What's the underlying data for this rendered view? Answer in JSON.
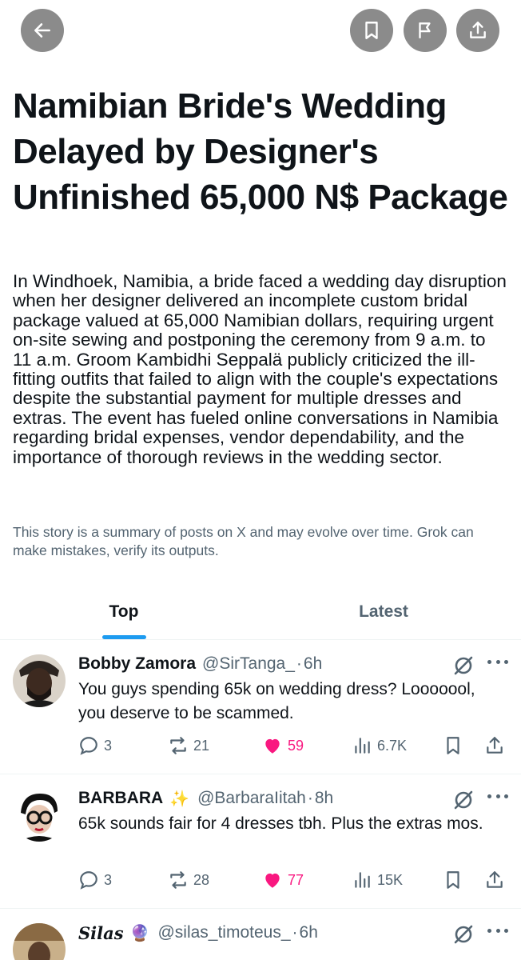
{
  "topbar": {
    "back_icon": "arrow-left-icon",
    "bookmark_icon": "bookmark-icon",
    "flag_icon": "flag-icon",
    "share_icon": "share-icon"
  },
  "article": {
    "headline": "Namibian Bride's Wedding Delayed by Designer's Unfinished 65,000 N$ Package",
    "summary": "In Windhoek, Namibia, a bride faced a wedding day disruption when her designer delivered an incomplete custom bridal package valued at 65,000 Namibian dollars, requiring urgent on-site sewing and postponing the ceremony from 9 a.m. to 11 a.m. Groom Kambidhi Seppalä publicly criticized the ill-fitting outfits that failed to align with the couple's expectations despite the substantial payment for multiple dresses and extras. The event has fueled online conversations in Namibia regarding bridal expenses, vendor dependability, and the importance of thorough reviews in the wedding sector.",
    "disclaimer": "This story is a summary of posts on X and may evolve over time. Grok can make mistakes, verify its outputs."
  },
  "tabs": [
    {
      "label": "Top",
      "active": true
    },
    {
      "label": "Latest",
      "active": false
    }
  ],
  "posts": [
    {
      "author": "Bobby Zamora",
      "badge": "",
      "handle": "@SirTanga_",
      "dot": "·",
      "time": "6h",
      "text": "You guys spending 65k on wedding dress? Looooool, you deserve to be scammed.",
      "replies": "3",
      "reposts": "21",
      "likes": "59",
      "views": "6.7K"
    },
    {
      "author": "BARBARA",
      "badge": "✨",
      "handle": "@BarbaraIitah",
      "dot": "·",
      "time": "8h",
      "text": "65k sounds fair for 4 dresses tbh. Plus the extras mos.",
      "replies": "3",
      "reposts": "28",
      "likes": "77",
      "views": "15K"
    },
    {
      "author": "Silas",
      "badge": "🔮",
      "handle": "@silas_timoteus_",
      "dot": "·",
      "time": "6h",
      "text": ""
    }
  ],
  "colors": {
    "accent": "#1d9bf0",
    "like": "#f91880",
    "muted": "#536471",
    "button_bg": "#8b8b8b"
  }
}
